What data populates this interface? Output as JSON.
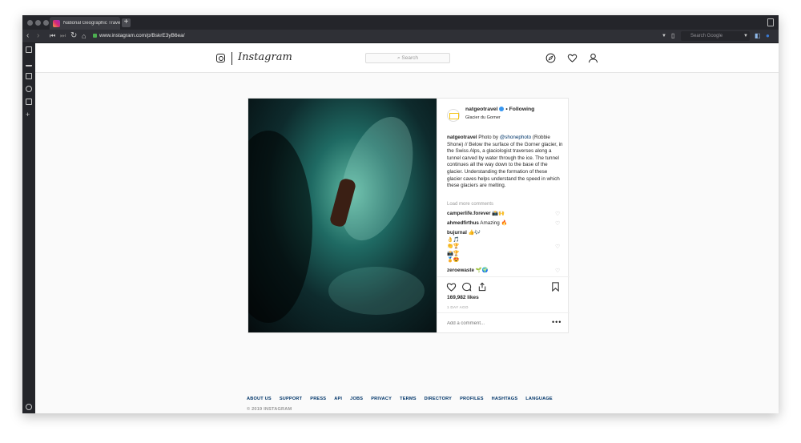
{
  "browser": {
    "tab_title": "National Geographic Travel",
    "new_tab_label": "+",
    "url": "www.instagram.com/p/BskrE3yB6ea/",
    "search_placeholder": "Search Google"
  },
  "instagram": {
    "wordmark": "Instagram",
    "search_placeholder": "Search"
  },
  "post": {
    "username": "natgeotravel",
    "following_label": "• Following",
    "location": "Glacier du Gorner",
    "caption_user": "natgeotravel",
    "caption_prefix": "Photo by",
    "caption_mention": "@shonephoto",
    "caption_text": "(Robbie Shone) // Below the surface of the Gorner glacier, in the Swiss Alps, a glaciologist traverses along a tunnel carved by water through the ice. The tunnel continues all the way down to the base of the glacier. Understanding the formation of these glacier caves helps understand the speed in which these glaciers are melting.",
    "load_more": "Load more comments",
    "comments": [
      {
        "user": "camperlife.forever",
        "text": "📸🙌"
      },
      {
        "user": "ahmedfirthus",
        "text": "Amazing 🔥"
      },
      {
        "user": "bujurnal",
        "text": "👍🎶\n👌🎵\n👏🏆\n📸🏆\n🏅😍"
      },
      {
        "user": "zeroewaste",
        "text": "🌱🌍"
      }
    ],
    "likes": "169,982 likes",
    "time_ago": "1 DAY AGO",
    "add_comment_placeholder": "Add a comment...",
    "more_label": "•••"
  },
  "footer": {
    "links": [
      "ABOUT US",
      "SUPPORT",
      "PRESS",
      "API",
      "JOBS",
      "PRIVACY",
      "TERMS",
      "DIRECTORY",
      "PROFILES",
      "HASHTAGS",
      "LANGUAGE"
    ],
    "copyright": "© 2019 INSTAGRAM"
  }
}
